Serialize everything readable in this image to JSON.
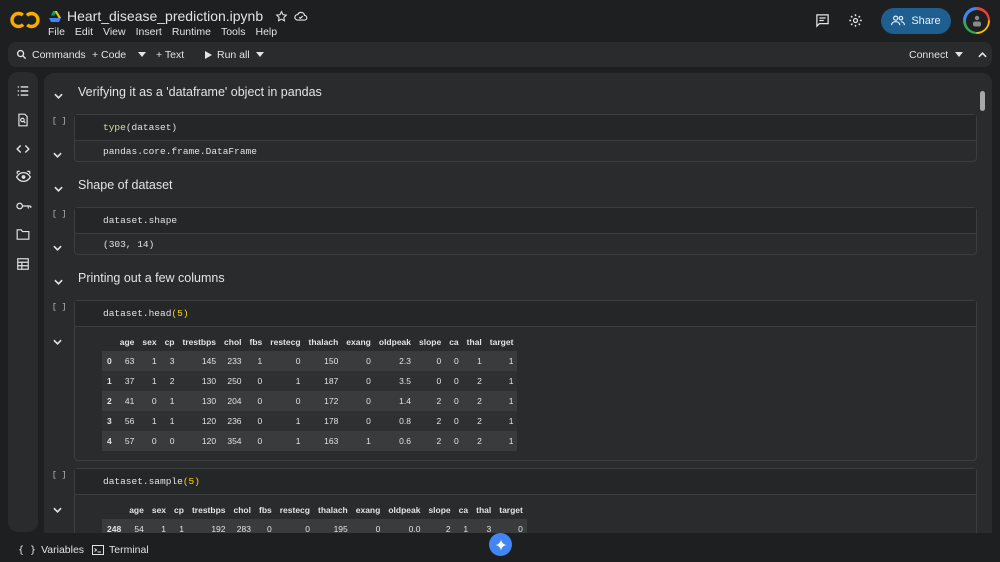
{
  "app": {
    "doc_title": "Heart_disease_prediction.ipynb",
    "menu": [
      "File",
      "Edit",
      "View",
      "Insert",
      "Runtime",
      "Tools",
      "Help"
    ],
    "share_label": "Share"
  },
  "toolbar": {
    "commands": "Commands",
    "code": "+ Code",
    "text": "+ Text",
    "run_all": "Run all",
    "connect": "Connect"
  },
  "sections": [
    {
      "title": "Verifying it as a 'dataframe' object in pandas"
    },
    {
      "title": "Shape of dataset"
    },
    {
      "title": "Printing out a few columns"
    }
  ],
  "cells": [
    {
      "indicator": "[ ]",
      "code_fn": "type",
      "code_arg": "(dataset)",
      "output": "pandas.core.frame.DataFrame"
    },
    {
      "indicator": "[ ]",
      "code": "dataset.shape",
      "output": "(303, 14)"
    },
    {
      "indicator": "[ ]",
      "code_fn": "dataset.head",
      "code_arg": "(5)"
    },
    {
      "indicator": "[ ]",
      "code_fn": "dataset.sample",
      "code_arg": "(5)"
    }
  ],
  "head_table": {
    "columns": [
      "",
      "age",
      "sex",
      "cp",
      "trestbps",
      "chol",
      "fbs",
      "restecg",
      "thalach",
      "exang",
      "oldpeak",
      "slope",
      "ca",
      "thal",
      "target"
    ],
    "rows": [
      [
        "0",
        "63",
        "1",
        "3",
        "145",
        "233",
        "1",
        "0",
        "150",
        "0",
        "2.3",
        "0",
        "0",
        "1",
        "1"
      ],
      [
        "1",
        "37",
        "1",
        "2",
        "130",
        "250",
        "0",
        "1",
        "187",
        "0",
        "3.5",
        "0",
        "0",
        "2",
        "1"
      ],
      [
        "2",
        "41",
        "0",
        "1",
        "130",
        "204",
        "0",
        "0",
        "172",
        "0",
        "1.4",
        "2",
        "0",
        "2",
        "1"
      ],
      [
        "3",
        "56",
        "1",
        "1",
        "120",
        "236",
        "0",
        "1",
        "178",
        "0",
        "0.8",
        "2",
        "0",
        "2",
        "1"
      ],
      [
        "4",
        "57",
        "0",
        "0",
        "120",
        "354",
        "0",
        "1",
        "163",
        "1",
        "0.6",
        "2",
        "0",
        "2",
        "1"
      ]
    ]
  },
  "sample_table": {
    "columns": [
      "",
      "age",
      "sex",
      "cp",
      "trestbps",
      "chol",
      "fbs",
      "restecg",
      "thalach",
      "exang",
      "oldpeak",
      "slope",
      "ca",
      "thal",
      "target"
    ],
    "rows": [
      [
        "248",
        "54",
        "1",
        "1",
        "192",
        "283",
        "0",
        "0",
        "195",
        "0",
        "0.0",
        "2",
        "1",
        "3",
        "0"
      ]
    ]
  },
  "footer": {
    "variables": "Variables",
    "terminal": "Terminal"
  }
}
